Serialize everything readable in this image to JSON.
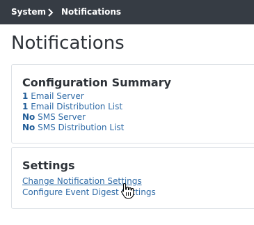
{
  "breadcrumb": {
    "items": [
      "System",
      "Notifications"
    ]
  },
  "page": {
    "title": "Notifications"
  },
  "config_summary": {
    "heading": "Configuration Summary",
    "items": [
      {
        "count": "1",
        "label": "Email Server"
      },
      {
        "count": "1",
        "label": "Email Distribution List"
      },
      {
        "count": "No",
        "label": "SMS Server"
      },
      {
        "count": "No",
        "label": "SMS Distribution List"
      }
    ]
  },
  "settings": {
    "heading": "Settings",
    "links": [
      "Change Notification Settings",
      "Configure Event Digest Settings"
    ]
  },
  "icons": {
    "breadcrumb_separator": "chevron-right-icon",
    "cursor": "hand-pointer-icon"
  },
  "colors": {
    "topbar": "#363c44",
    "link": "#2f6ba7",
    "text": "#2d3238"
  }
}
